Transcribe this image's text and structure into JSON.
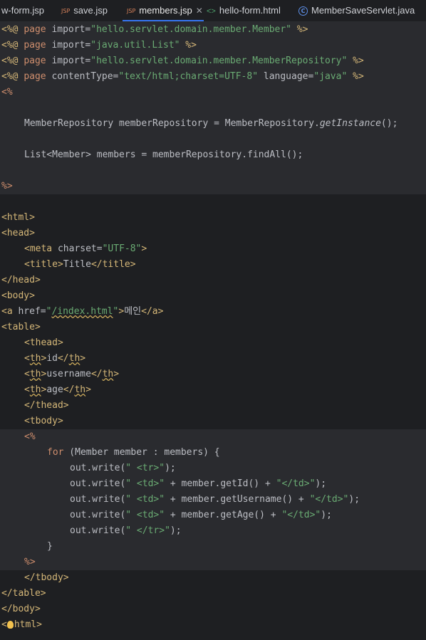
{
  "tabs": [
    {
      "label": "w-form.jsp",
      "icon": "jsp-icon"
    },
    {
      "label": "save.jsp",
      "icon": "jsp-icon"
    },
    {
      "label": "members.jsp",
      "icon": "jsp-icon",
      "active": true
    },
    {
      "label": "hello-form.html",
      "icon": "html-icon"
    },
    {
      "label": "MemberSaveServlet.java",
      "icon": "class-icon"
    }
  ],
  "icons": {
    "jsp": "JSP",
    "html": "<>",
    "class": "C",
    "close": "✕"
  },
  "code": {
    "l1": {
      "a": "<%@ ",
      "b": "page",
      "c": " import=",
      "d": "\"hello.servlet.domain.member.Member\"",
      "e": " %>"
    },
    "l2": {
      "a": "<%@ ",
      "b": "page",
      "c": " import=",
      "d": "\"java.util.List\"",
      "e": " %>"
    },
    "l3": {
      "a": "<%@ ",
      "b": "page",
      "c": " import=",
      "d": "\"hello.servlet.domain.member.MemberRepository\"",
      "e": " %>"
    },
    "l4": {
      "a": "<%@ ",
      "b": "page",
      "c": " contentType=",
      "d": "\"text/html;charset=UTF-8\"",
      "e": " language=",
      "f": "\"java\"",
      "g": " %>"
    },
    "l5": "<%",
    "l7": {
      "a": "MemberRepository memberRepository = MemberRepository.",
      "b": "getInstance",
      "c": "();"
    },
    "l9": "List<Member> members = memberRepository.findAll();",
    "l11": "%>",
    "l13": "<html>",
    "l14": "<head>",
    "l15": {
      "a": "<meta ",
      "b": "charset=",
      "c": "\"UTF-8\"",
      "d": ">"
    },
    "l16": {
      "a": "<title>",
      "b": "Title",
      "c": "</title>"
    },
    "l17": "</head>",
    "l18": "<body>",
    "l19": {
      "a": "<a ",
      "b": "href=",
      "c": "\"",
      "d": "/index.html",
      "e": "\"",
      "f": ">",
      "g": "메인",
      "h": "</a>"
    },
    "l20": "<table>",
    "l21": "<thead>",
    "l22": {
      "a": "<",
      "b": "th",
      "c": ">",
      "d": "id",
      "e": "</",
      "f": "th",
      "g": ">"
    },
    "l23": {
      "a": "<",
      "b": "th",
      "c": ">",
      "d": "username",
      "e": "</",
      "f": "th",
      "g": ">"
    },
    "l24": {
      "a": "<",
      "b": "th",
      "c": ">",
      "d": "age",
      "e": "</",
      "f": "th",
      "g": ">"
    },
    "l25": "</thead>",
    "l26": "<tbody>",
    "l27": "<%",
    "l28": {
      "a": "for",
      "b": " (Member member : members) {"
    },
    "l29": {
      "a": "out.write(",
      "b": "\" <tr>\"",
      "c": ");"
    },
    "l30": {
      "a": "out.write(",
      "b": "\" <td>\"",
      "c": " + member.getId() + ",
      "d": "\"</td>\"",
      "e": ");"
    },
    "l31": {
      "a": "out.write(",
      "b": "\" <td>\"",
      "c": " + member.getUsername() + ",
      "d": "\"</td>\"",
      "e": ");"
    },
    "l32": {
      "a": "out.write(",
      "b": "\" <td>\"",
      "c": " + member.getAge() + ",
      "d": "\"</td>\"",
      "e": ");"
    },
    "l33": {
      "a": "out.write(",
      "b": "\" </tr>\"",
      "c": ");"
    },
    "l34": "}",
    "l35": "%>",
    "l36": "</tbody>",
    "l37": "</table>",
    "l38": "</body>",
    "l39": {
      "a": "<",
      "b": "html>"
    }
  }
}
